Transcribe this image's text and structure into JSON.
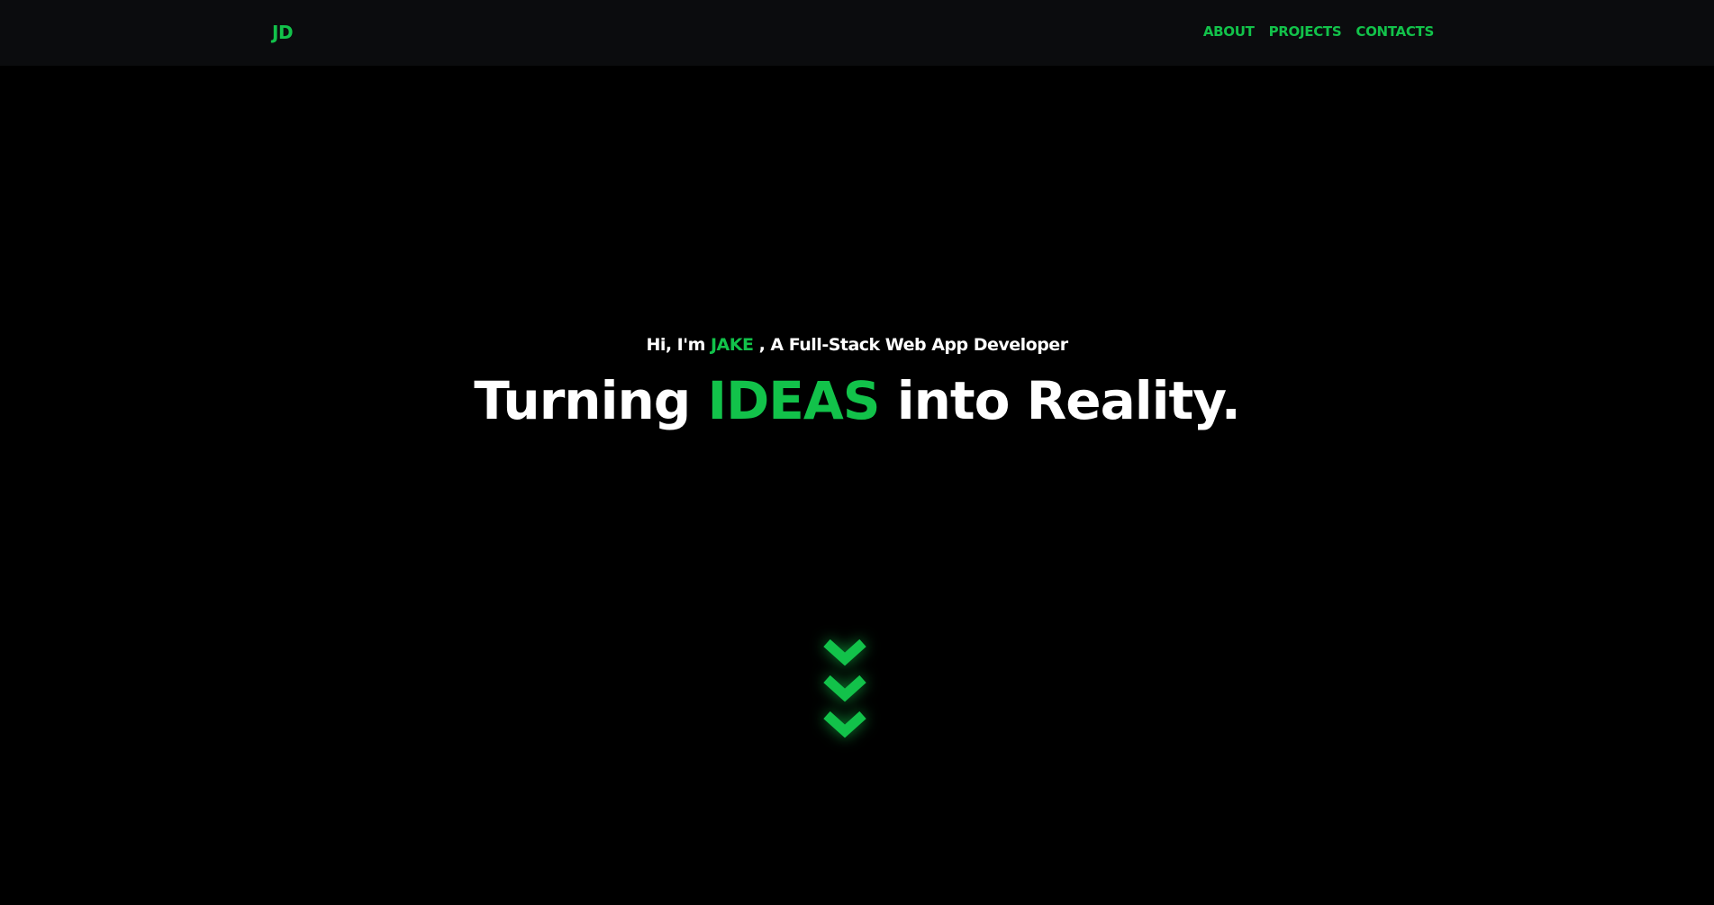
{
  "nav": {
    "logo": "JD",
    "links": [
      {
        "label": "ABOUT"
      },
      {
        "label": "PROJECTS"
      },
      {
        "label": "CONTACTS"
      }
    ]
  },
  "hero": {
    "intro_prefix": "Hi, I'm ",
    "intro_name": "JAKE",
    "intro_suffix": " , A Full-Stack Web App Developer",
    "headline_prefix": "Turning ",
    "headline_accent": "IDEAS",
    "headline_suffix": " into Reality.",
    "scroll_icon": "chevrons-down-icon"
  },
  "colors": {
    "background": "#000000",
    "navbar": "#0b0c0e",
    "accent": "#12c24a",
    "text": "#ffffff"
  }
}
